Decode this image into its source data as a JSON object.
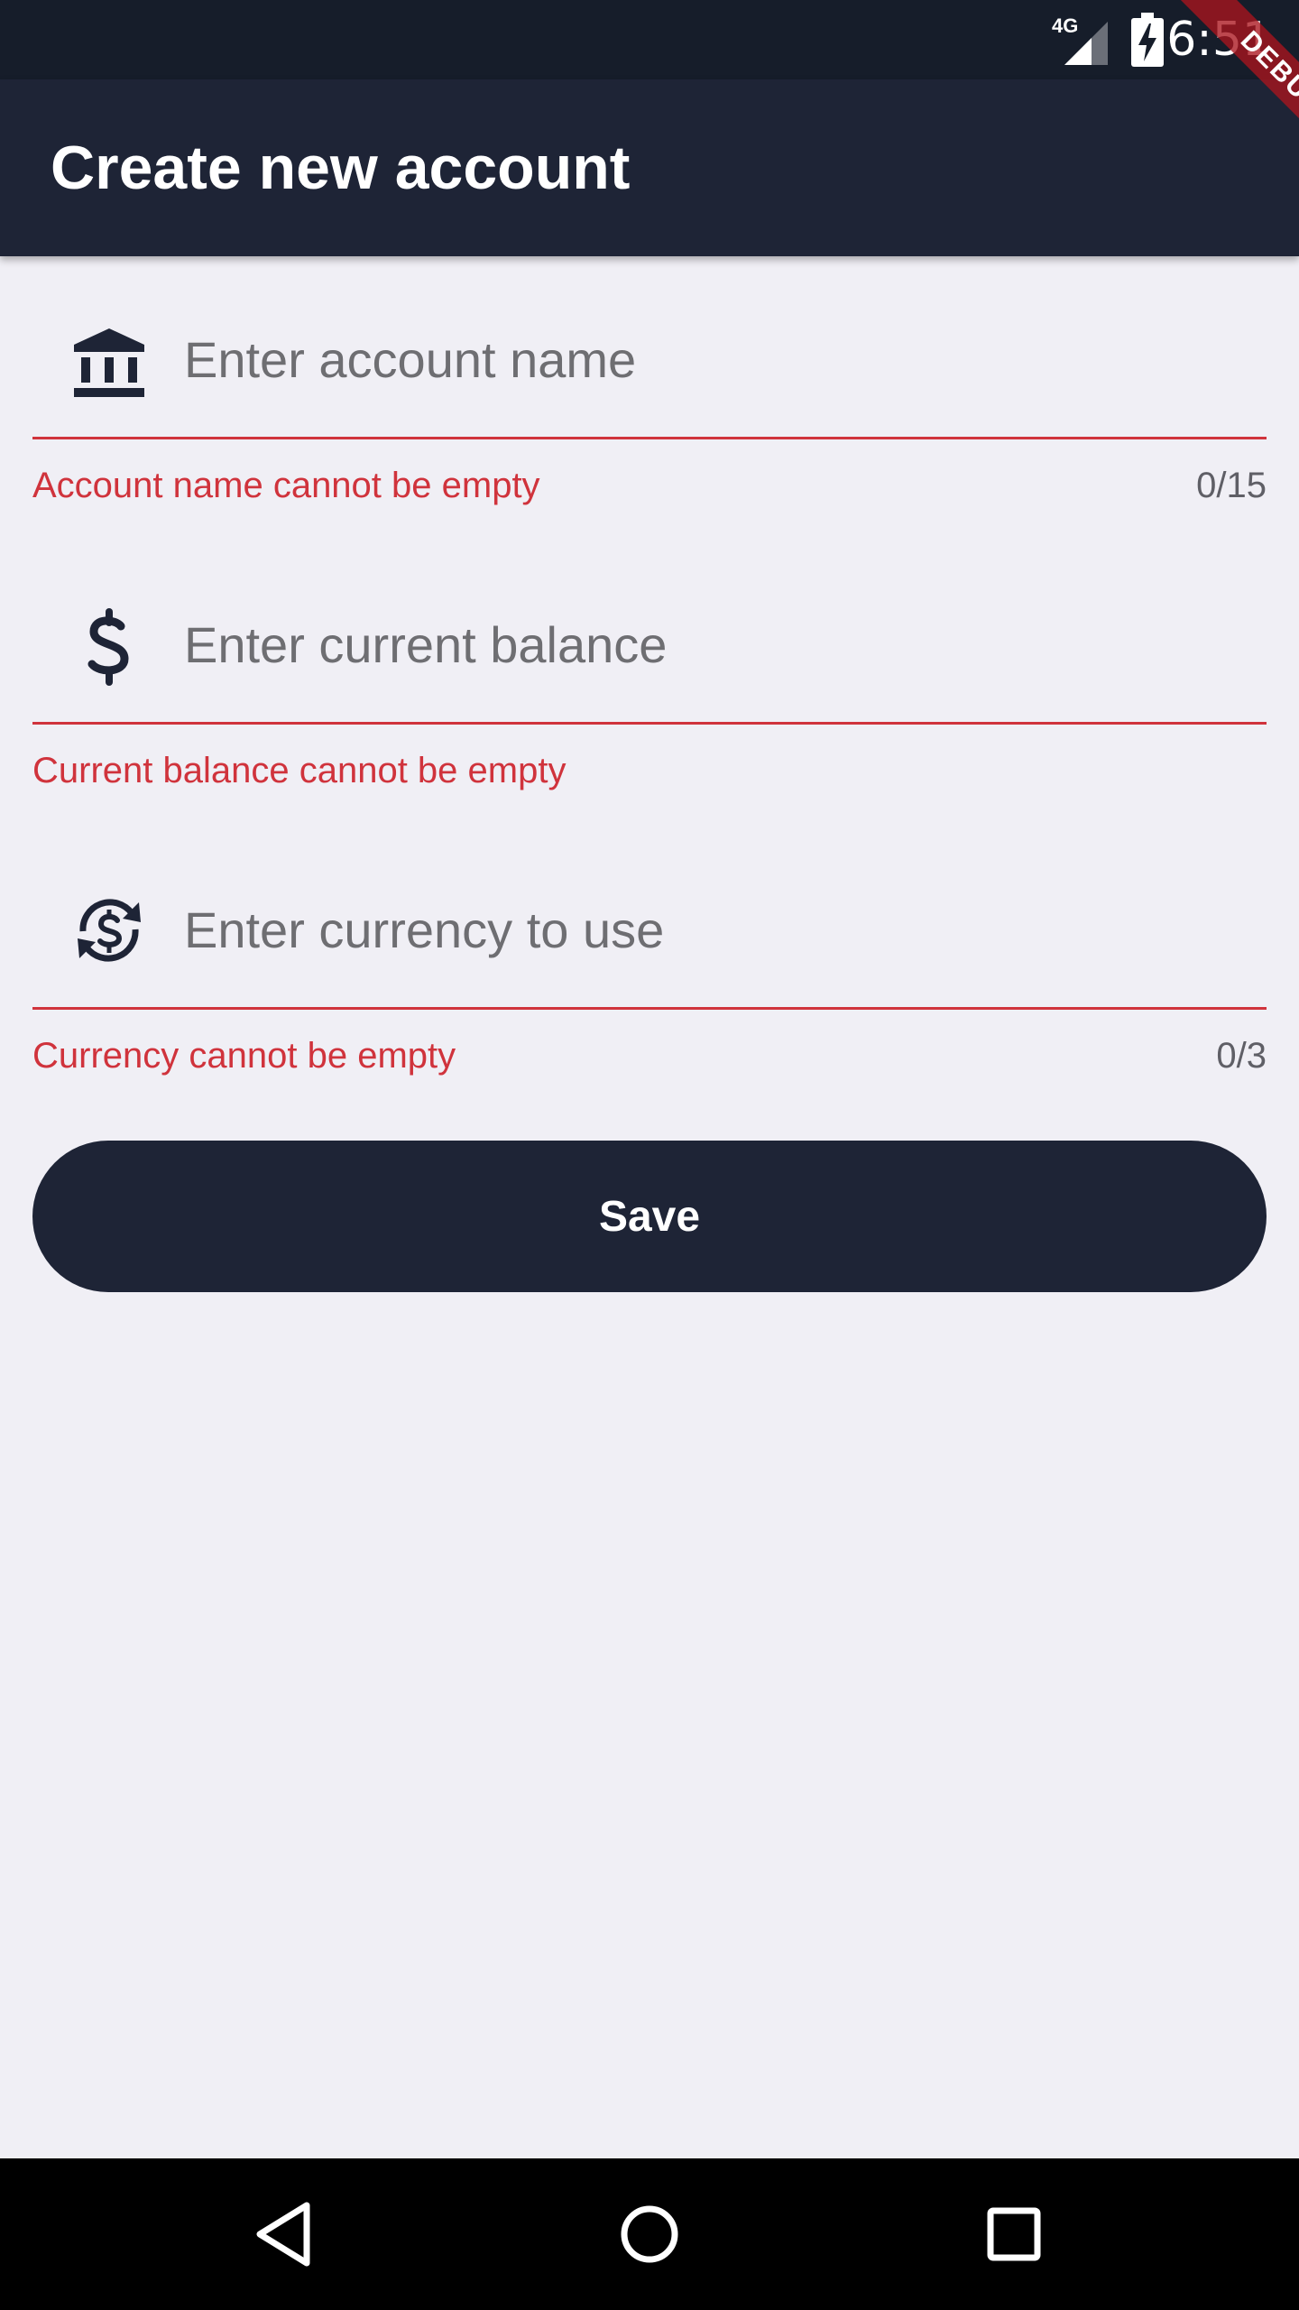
{
  "status_bar": {
    "network": "4G",
    "time": "6:51",
    "signal_icon": "signal-icon",
    "battery_icon": "battery-charging-icon"
  },
  "debug_banner": "DEBUG",
  "app_bar": {
    "title": "Create new account"
  },
  "form": {
    "account_name": {
      "icon": "bank-icon",
      "value": "",
      "placeholder": "Enter account name",
      "error": "Account name cannot be empty",
      "counter": "0/15"
    },
    "balance": {
      "icon": "dollar-icon",
      "value": "",
      "placeholder": "Enter current balance",
      "error": "Current balance cannot be empty"
    },
    "currency": {
      "icon": "currency-exchange-icon",
      "value": "",
      "placeholder": "Enter currency to use",
      "error": "Currency cannot be empty",
      "counter": "0/3"
    },
    "save_label": "Save"
  },
  "nav_bar": {
    "back_icon": "back-triangle-icon",
    "home_icon": "home-circle-icon",
    "recents_icon": "recents-square-icon"
  },
  "colors": {
    "primary": "#1e2436",
    "error": "#d0333c",
    "background": "#f0eff5",
    "status_bar": "#161d2a"
  }
}
